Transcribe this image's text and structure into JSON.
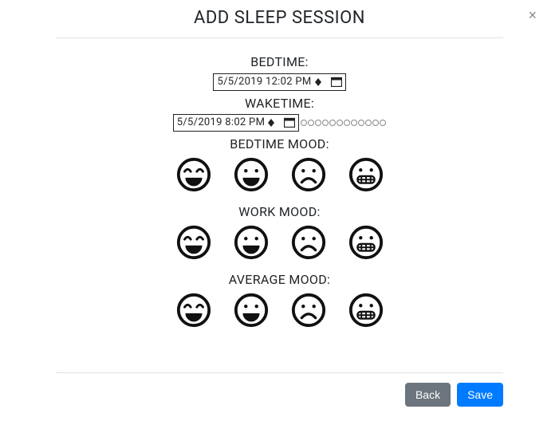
{
  "header": {
    "title": "ADD SLEEP SESSION",
    "close_label": "×"
  },
  "form": {
    "bedtime_label": "BEDTIME:",
    "bedtime_value": "5/5/2019 12:02 PM",
    "waketime_label": "WAKETIME:",
    "waketime_value": "5/5/2019 8:02 PM",
    "bedtime_mood_label": "BEDTIME MOOD:",
    "work_mood_label": "WORK MOOD:",
    "average_mood_label": "AVERAGE MOOD:",
    "moods": [
      "very-happy",
      "happy",
      "sad",
      "grimace"
    ]
  },
  "footer": {
    "back_label": "Back",
    "save_label": "Save"
  }
}
